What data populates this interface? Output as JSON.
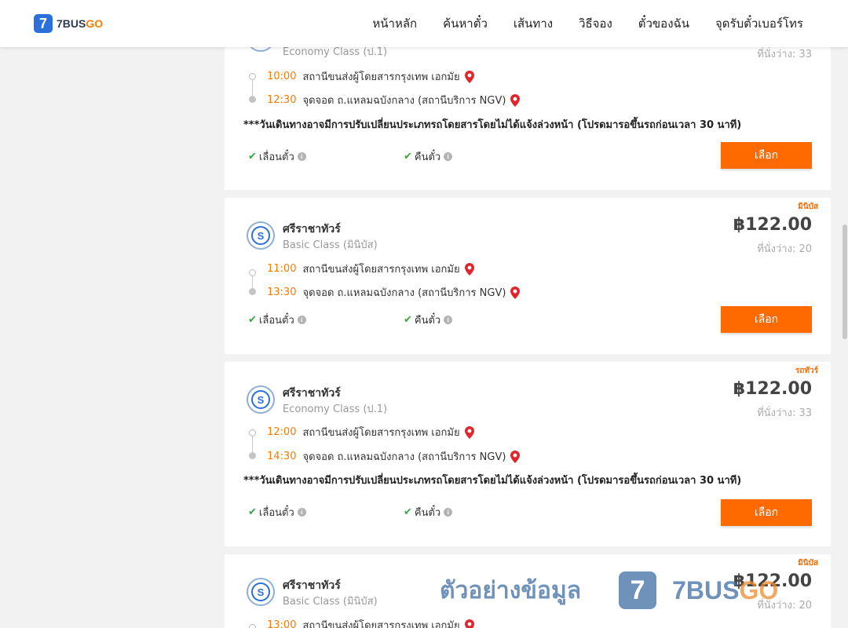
{
  "header": {
    "logo_number": "7",
    "logo_text_main": "7BUS",
    "logo_text_accent": "GO",
    "nav": [
      "หน้าหลัก",
      "ค้นหาตั๋ว",
      "เส้นทาง",
      "วิธีจอง",
      "ตั๋วของฉัน",
      "จุดรับตั๋วเบอร์โทร"
    ]
  },
  "cards": [
    {
      "badge": "",
      "operator": "",
      "class": "Economy Class (ป.1)",
      "price": "",
      "seats": "ที่นั่งว่าง: 33",
      "depart_time": "10:00",
      "depart_place": "สถานีขนส่งผู้โดยสารกรุงเทพ เอกมัย",
      "arrive_time": "12:30",
      "arrive_place": "จุดจอด ถ.แหลมฉบังกลาง (สถานีบริการ NGV)",
      "notice": "***วันเดินทางอาจมีการปรับเปลี่ยนประเภทรถโดยสารโดยไม่ได้แจ้งล่วงหน้า (โปรดมารอขึ้นรถก่อนเวลา 30 นาที)",
      "feature_change": "เลื่อนตั๋ว",
      "feature_refund": "คืนตั๋ว",
      "button": "เลือก"
    },
    {
      "badge": "มินิบัส",
      "operator": "ศรีราชาทัวร์",
      "class": "Basic Class (มินิบัส)",
      "price": "฿122.00",
      "seats": "ที่นั่งว่าง: 20",
      "depart_time": "11:00",
      "depart_place": "สถานีขนส่งผู้โดยสารกรุงเทพ เอกมัย",
      "arrive_time": "13:30",
      "arrive_place": "จุดจอด ถ.แหลมฉบังกลาง (สถานีบริการ NGV)",
      "notice": "",
      "feature_change": "เลื่อนตั๋ว",
      "feature_refund": "คืนตั๋ว",
      "button": "เลือก"
    },
    {
      "badge": "รถทัวร์",
      "operator": "ศรีราชาทัวร์",
      "class": "Economy Class (ป.1)",
      "price": "฿122.00",
      "seats": "ที่นั่งว่าง: 33",
      "depart_time": "12:00",
      "depart_place": "สถานีขนส่งผู้โดยสารกรุงเทพ เอกมัย",
      "arrive_time": "14:30",
      "arrive_place": "จุดจอด ถ.แหลมฉบังกลาง (สถานีบริการ NGV)",
      "notice": "***วันเดินทางอาจมีการปรับเปลี่ยนประเภทรถโดยสารโดยไม่ได้แจ้งล่วงหน้า (โปรดมารอขึ้นรถก่อนเวลา 30 นาที)",
      "feature_change": "เลื่อนตั๋ว",
      "feature_refund": "คืนตั๋ว",
      "button": "เลือก"
    },
    {
      "badge": "มินิบัส",
      "operator": "ศรีราชาทัวร์",
      "class": "Basic Class (มินิบัส)",
      "price": "฿122.00",
      "seats": "ที่นั่งว่าง: 20",
      "depart_time": "13:00",
      "depart_place": "สถานีขนส่งผู้โดยสารกรุงเทพ เอกมัย"
    }
  ],
  "watermark": {
    "text": "ตัวอย่างข้อมูล",
    "brand_main": "7BUS",
    "brand_accent": "GO",
    "mark": "7"
  },
  "colors": {
    "accent_orange": "#ff6a00",
    "brand_blue": "#2b6fdb",
    "check_green": "#3aa24b",
    "page_bg": "#f2f2f2"
  }
}
